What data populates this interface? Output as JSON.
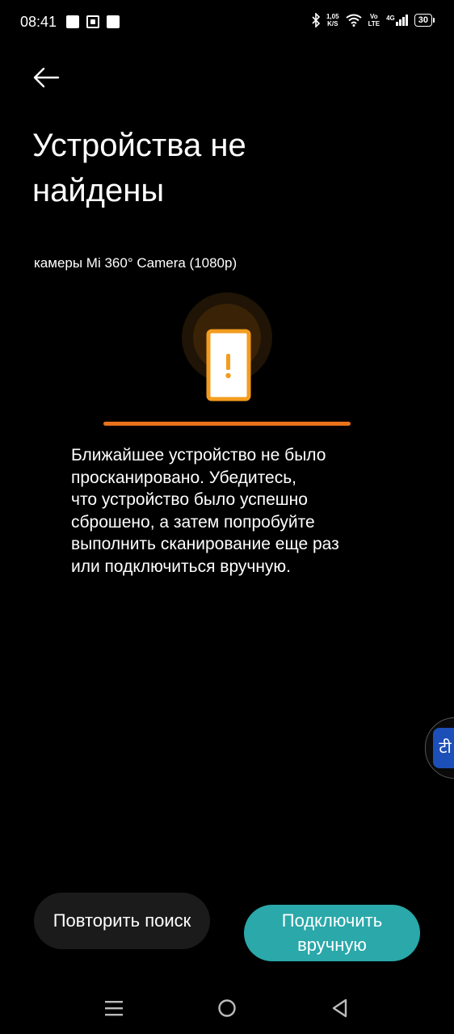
{
  "status_bar": {
    "time": "08:41",
    "speed_top": "1,05",
    "speed_bottom": "K/S",
    "volte_top": "Vo",
    "volte_bottom": "LTE",
    "network": "4G",
    "battery": "30"
  },
  "header": {
    "title_line1": "Устройства не",
    "title_line2": "найдены",
    "subtitle": "камеры Mi 360° Camera (1080p)"
  },
  "illustration": {
    "accent_color": "#f39c1f",
    "progress_color": "#e8721c",
    "icon": "phone-warning-icon"
  },
  "message": {
    "line1": "Ближайшее устройство не было",
    "line2": "просканировано. Убедитесь,",
    "line3": "что устройство было успешно",
    "line4": "сброшено, а затем попробуйте",
    "line5": "выполнить сканирование еще раз",
    "line6": "или подключиться вручную."
  },
  "floating_widget": {
    "glyph": "टी"
  },
  "actions": {
    "retry_label": "Повторить поиск",
    "manual_line1": "Подключить",
    "manual_line2": "вручную"
  },
  "colors": {
    "background": "#000000",
    "primary_button": "#2aa8aa",
    "secondary_button": "#1b1b1b"
  }
}
